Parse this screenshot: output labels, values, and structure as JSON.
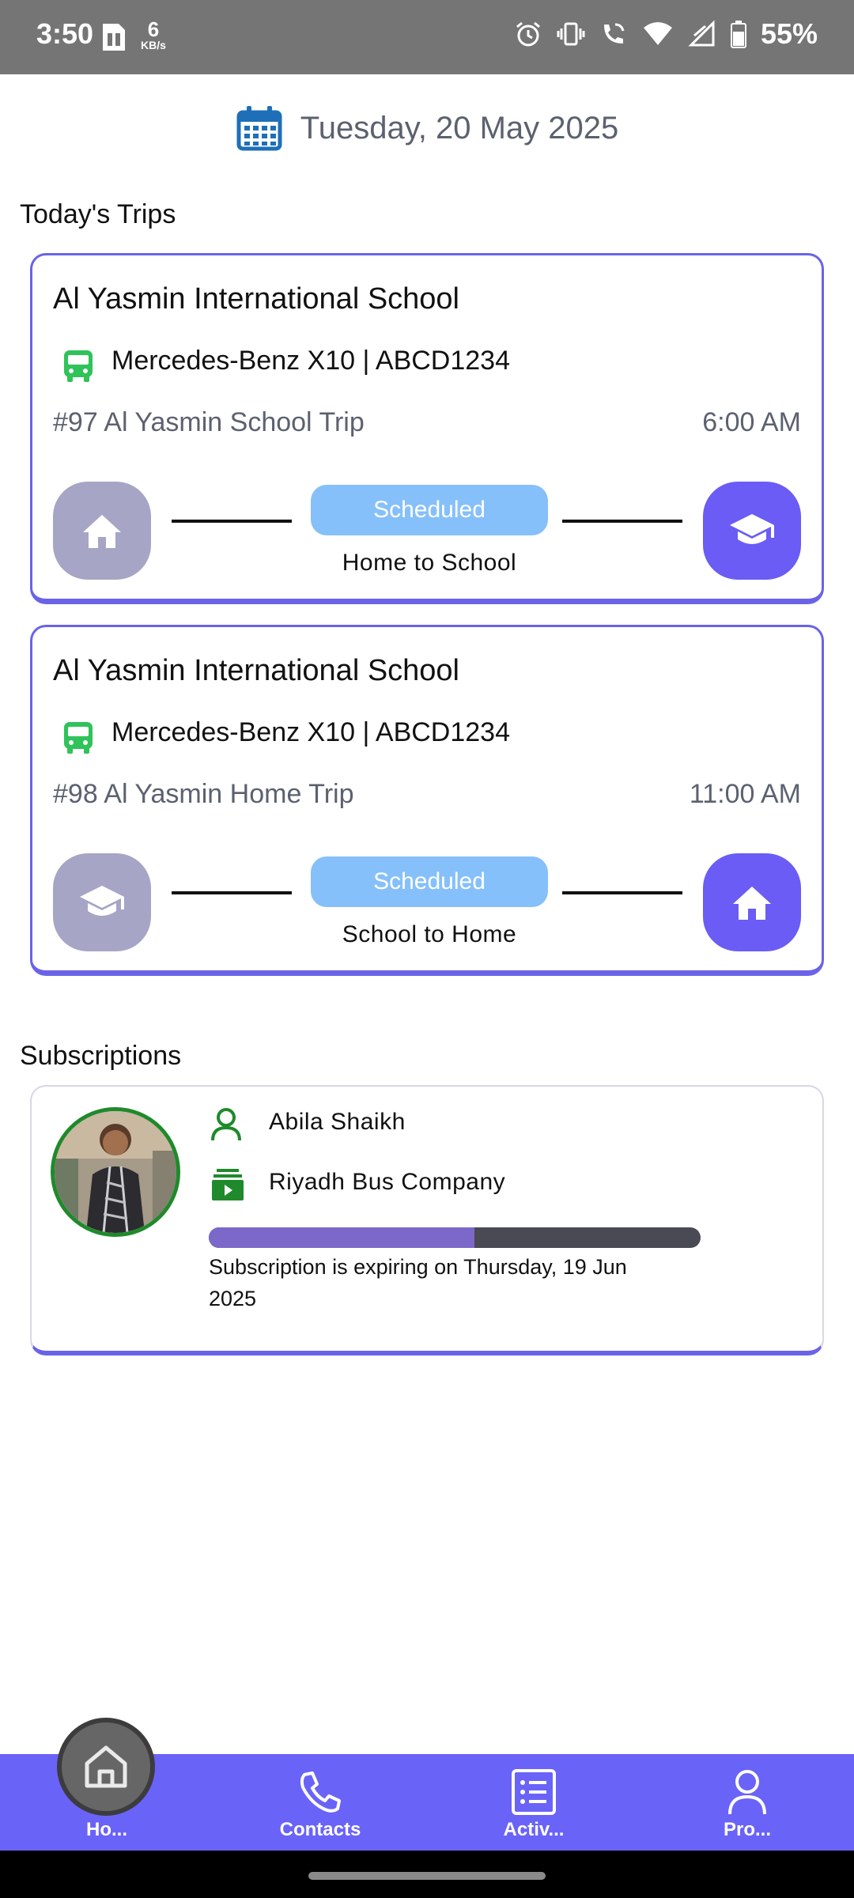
{
  "status_bar": {
    "time": "3:50",
    "net_speed_value": "6",
    "net_speed_unit": "KB/s",
    "battery": "55%"
  },
  "header": {
    "date": "Tuesday, 20 May 2025",
    "icon": "calendar-icon"
  },
  "trips_section": {
    "title": "Today's Trips",
    "trips": [
      {
        "school": "Al Yasmin International School",
        "vehicle": "Mercedes-Benz X10 | ABCD1234",
        "trip_name": "#97 Al Yasmin School Trip",
        "time": "6:00 AM",
        "status": "Scheduled",
        "direction": "Home to School",
        "start_icon": "home-icon",
        "end_icon": "school-cap-icon"
      },
      {
        "school": "Al Yasmin International School",
        "vehicle": "Mercedes-Benz X10 | ABCD1234",
        "trip_name": "#98 Al Yasmin Home Trip",
        "time": "11:00 AM",
        "status": "Scheduled",
        "direction": "School to Home",
        "start_icon": "school-cap-icon",
        "end_icon": "home-icon"
      }
    ]
  },
  "subscriptions_section": {
    "title": "Subscriptions",
    "items": [
      {
        "student_name": "Abila Shaikh",
        "company": "Riyadh Bus Company",
        "progress_fraction": 0.54,
        "expiry_text": "Subscription is expiring on Thursday, 19 Jun 2025"
      }
    ]
  },
  "bottom_nav": {
    "items": [
      {
        "label": "Ho...",
        "icon": "home-icon",
        "active": true
      },
      {
        "label": "Contacts",
        "icon": "phone-icon"
      },
      {
        "label": "Activ...",
        "icon": "list-icon"
      },
      {
        "label": "Pro...",
        "icon": "user-icon"
      }
    ]
  },
  "colors": {
    "accent": "#6a63f8",
    "card_border": "#6a63e8",
    "scheduled_pill": "#86c0fa",
    "node_inactive": "#a6a5c6",
    "node_active": "#6a5cf4",
    "bus_icon": "#2fc35a",
    "calendar_icon": "#1e6fb8",
    "subscription_icon_green": "#1f8a2b",
    "progress_fill": "#7c68c9",
    "progress_track": "#4a4a55"
  }
}
